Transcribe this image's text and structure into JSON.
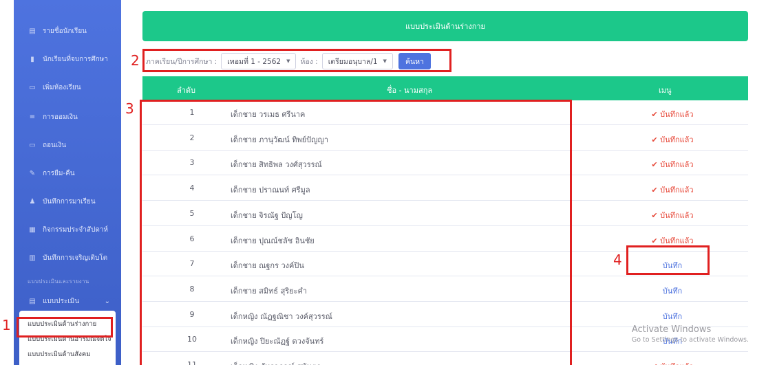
{
  "sidebar": {
    "items": [
      {
        "label": "รายชื่อนักเรียน",
        "icon": "list-icon"
      },
      {
        "label": "นักเรียนที่จบการศึกษา",
        "icon": "doc-icon"
      },
      {
        "label": "เพิ่มห้องเรียน",
        "icon": "chat-icon"
      },
      {
        "label": "การออมเงิน",
        "icon": "wallet-icon"
      },
      {
        "label": "ถอนเงิน",
        "icon": "card-icon"
      },
      {
        "label": "การยืม-คืน",
        "icon": "pen-icon"
      },
      {
        "label": "บันทึกการมาเรียน",
        "icon": "user-edit-icon"
      },
      {
        "label": "กิจกรรมประจำสัปดาห์",
        "icon": "calendar-icon"
      },
      {
        "label": "บันทึกการเจริญเติบโต",
        "icon": "chart-icon"
      }
    ],
    "section_heading": "แบบประเมินและรายงาน",
    "assessment_menu": "แบบประเมิน",
    "submenu": [
      "แบบประเมินด้านร่างกาย",
      "แบบประเมินด้านอารมณ์จิตใจ",
      "แบบประเมินด้านสังคม"
    ]
  },
  "panel_title": "แบบประเมินด้านร่างกาย",
  "filter": {
    "term_label": "ภาคเรียน/ปีการศึกษา :",
    "term_value": "เทอมที่ 1 - 2562",
    "room_label": "ห้อง :",
    "room_value": "เตรียมอนุบาล/1",
    "search_label": "ค้นหา"
  },
  "table": {
    "headers": [
      "ลำดับ",
      "ชื่อ - นามสกุล",
      "เมนู"
    ],
    "rows": [
      {
        "no": "1",
        "name": "เด็กชาย วรเมธ ศรีนาค",
        "action": "✔ บันทึกแล้ว",
        "done": true
      },
      {
        "no": "2",
        "name": "เด็กชาย ภานุวัฒน์ ทิพย์ปัญญา",
        "action": "✔ บันทึกแล้ว",
        "done": true
      },
      {
        "no": "3",
        "name": "เด็กชาย สิทธิพล วงศ์สุวรรณ์",
        "action": "✔ บันทึกแล้ว",
        "done": true
      },
      {
        "no": "4",
        "name": "เด็กชาย ปราณนท์ ศรีมูล",
        "action": "✔ บันทึกแล้ว",
        "done": true
      },
      {
        "no": "5",
        "name": "เด็กชาย จิรณัฐ ปัญโญ",
        "action": "✔ บันทึกแล้ว",
        "done": true
      },
      {
        "no": "6",
        "name": "เด็กชาย ปุณณ์ชลัช อินชัย",
        "action": "✔ บันทึกแล้ว",
        "done": true
      },
      {
        "no": "7",
        "name": "เด็กชาย ณฐกร วงค์ปิน",
        "action": "บันทึก",
        "done": false
      },
      {
        "no": "8",
        "name": "เด็กชาย สมิทธ์ สุริยะคำ",
        "action": "บันทึก",
        "done": false
      },
      {
        "no": "9",
        "name": "เด็กหญิง ณัฏฐณิชา วงค์สุวรรณ์",
        "action": "บันทึก",
        "done": false
      },
      {
        "no": "10",
        "name": "เด็กหญิง ปิยะณัฏฐ์ ดวงจันทร์",
        "action": "บันทึก",
        "done": false
      },
      {
        "no": "11",
        "name": "เด็กหญิง ภัทราภรณ์ สุนันตา",
        "action": "✔ บันทึกแล้ว",
        "done": true
      }
    ]
  },
  "annotations": [
    "1",
    "2",
    "3",
    "4"
  ],
  "watermark": {
    "line1": "Activate Windows",
    "line2": "Go to Settings to activate Windows."
  },
  "colors": {
    "sidebar": "#4e73df",
    "accent_green": "#1cc88a",
    "done": "#e74a3b",
    "link": "#4e73df",
    "annotation": "#e02020"
  }
}
